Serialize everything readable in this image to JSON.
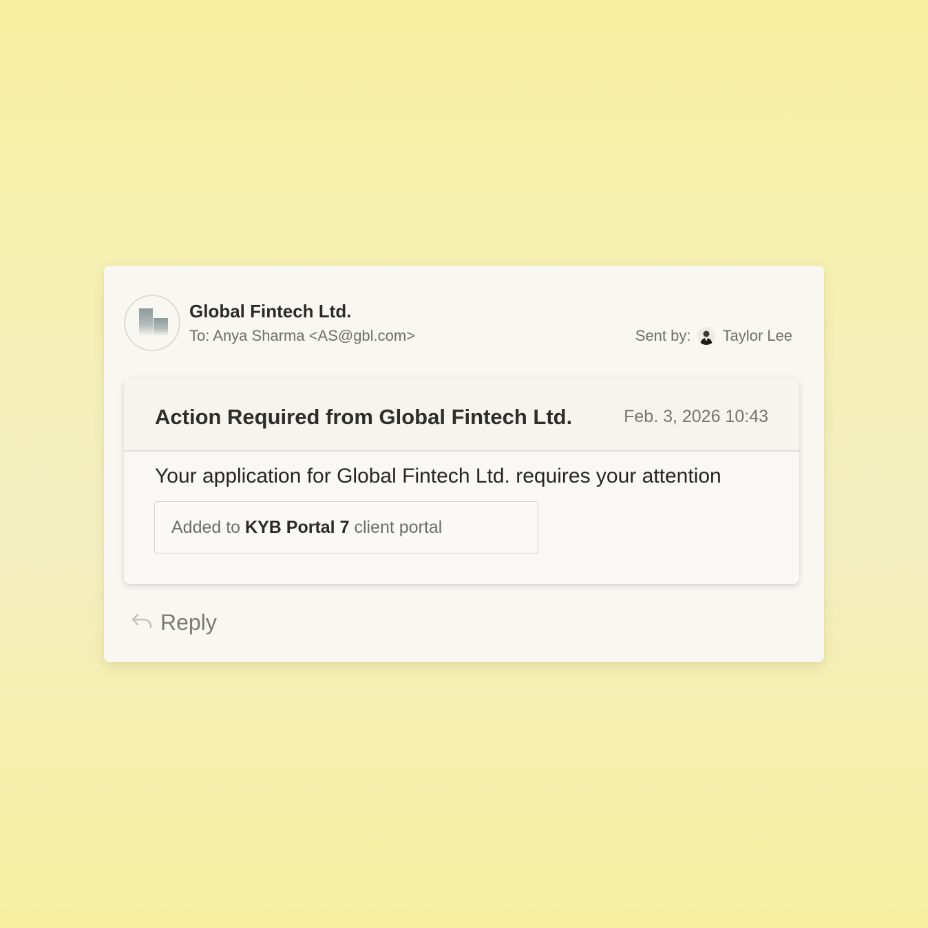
{
  "email": {
    "sender": "Global Fintech Ltd.",
    "to_label": "To:",
    "to_value": "Anya Sharma <AS@gbl.com>",
    "sent_by_label": "Sent by:",
    "sent_by_name": "Taylor Lee"
  },
  "message": {
    "subject": "Action Required from Global Fintech Ltd.",
    "date": "Feb. 3, 2026 10:43",
    "body": "Your application for Global Fintech Ltd. requires your attention",
    "portal_prefix": "Added to",
    "portal_name": "KYB Portal 7",
    "portal_suffix": "client portal"
  },
  "actions": {
    "reply_label": "Reply"
  },
  "icons": {
    "logo": "company-logo-icon",
    "avatar": "user-avatar",
    "reply": "reply-arrow-icon"
  },
  "colors": {
    "background": "#f6efa8",
    "card": "#f8f7f1",
    "text_primary": "#2a2a28",
    "text_secondary": "#6f6f6a"
  }
}
